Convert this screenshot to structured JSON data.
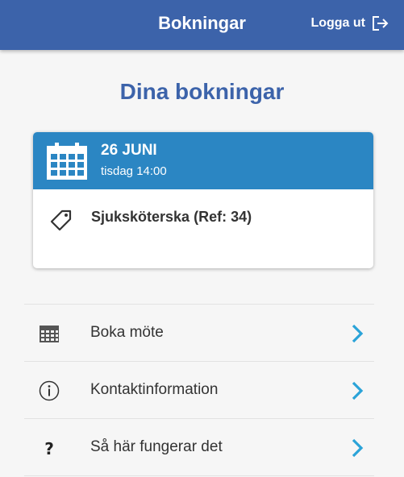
{
  "header": {
    "title": "Bokningar",
    "logout_label": "Logga ut",
    "logout_icon": "logout-icon",
    "bg_color": "#3c63aa"
  },
  "main": {
    "title": "Dina bokningar"
  },
  "booking": {
    "date": "26 JUNI",
    "time": "tisdag 14:00",
    "service": "Sjuksköterska (Ref: 34)",
    "head_color": "#2b86c3",
    "calendar_icon": "calendar-icon",
    "tag_icon": "tag-icon"
  },
  "menu": {
    "items": [
      {
        "label": "Boka möte",
        "icon": "calendar-icon"
      },
      {
        "label": "Kontaktinformation",
        "icon": "info-icon"
      },
      {
        "label": "Så här fungerar det",
        "icon": "question-icon"
      }
    ],
    "chevron_color": "#2aa3d8"
  }
}
